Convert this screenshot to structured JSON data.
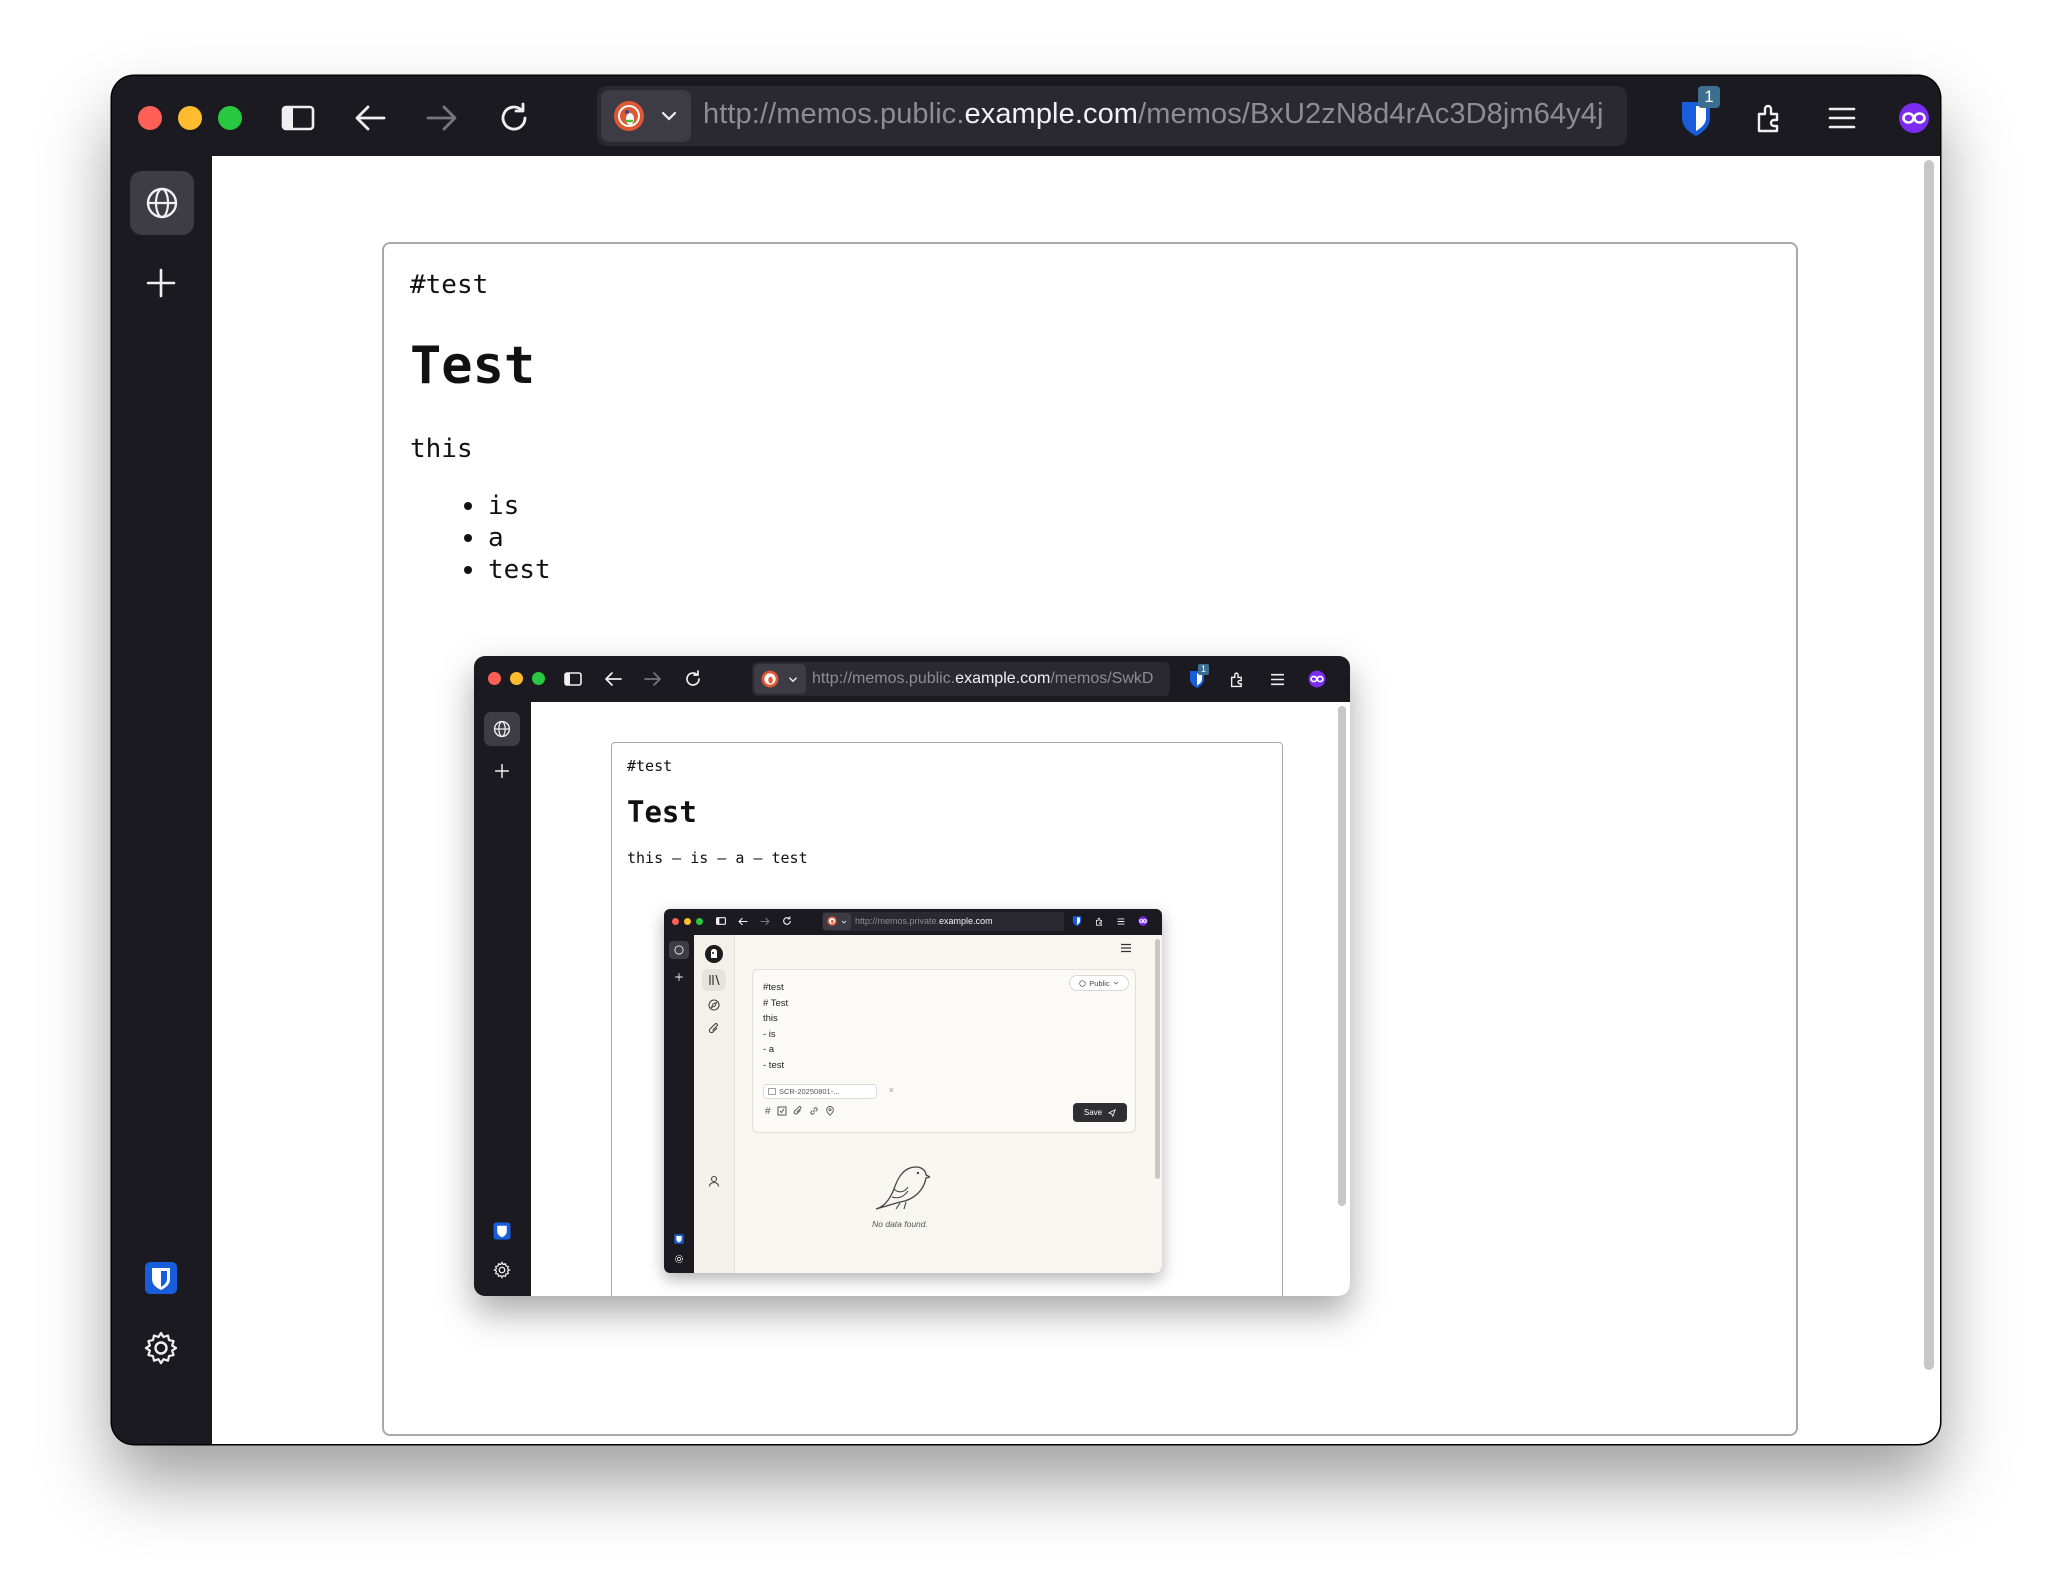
{
  "browser": {
    "url_scheme": "http://memos.public.",
    "url_domain": "example.com",
    "url_path": "/memos/BxU2zN8d4rAc3D8jm64y4j",
    "bitwarden_badge": "1"
  },
  "memo": {
    "tag": "#test",
    "heading": "Test",
    "paragraph": "this",
    "list": [
      "is",
      "a",
      "test"
    ]
  },
  "embedded": {
    "url_scheme": "http://memos.public.",
    "url_domain": "example.com",
    "url_path": "/memos/SwkD",
    "bitwarden_badge": "1",
    "memo": {
      "tag": "#test",
      "heading": "Test",
      "line": "this – is – a – test"
    },
    "nested": {
      "url_scheme": "http://memos.private.",
      "url_domain": "example.com",
      "editor_lines": [
        "#test",
        "# Test",
        "this",
        "- is",
        "- a",
        "- test"
      ],
      "visibility": "Public",
      "attachment": "SCR-20250801-...",
      "save_label": "Save",
      "empty_text": "No data found."
    }
  },
  "colors": {
    "chrome_bg": "#1b1a21",
    "traffic_red": "#fe5f57",
    "traffic_yellow": "#febc2e",
    "traffic_green": "#28c840",
    "bitwarden_blue": "#175ddc",
    "private_purple": "#7b2cf0"
  }
}
